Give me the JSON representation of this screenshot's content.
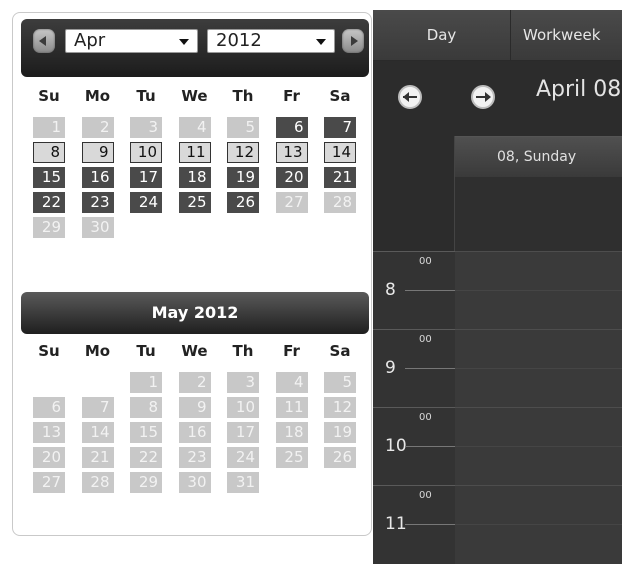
{
  "mini_calendar": {
    "month_select": "Apr",
    "year_select": "2012",
    "weekdays": [
      "Su",
      "Mo",
      "Tu",
      "We",
      "Th",
      "Fr",
      "Sa"
    ],
    "april": {
      "weeks": [
        [
          {
            "d": "1",
            "s": "other"
          },
          {
            "d": "2",
            "s": "other"
          },
          {
            "d": "3",
            "s": "other"
          },
          {
            "d": "4",
            "s": "other"
          },
          {
            "d": "5",
            "s": "other"
          },
          {
            "d": "6",
            "s": "dark"
          },
          {
            "d": "7",
            "s": "dark"
          }
        ],
        [
          {
            "d": "8",
            "s": "light"
          },
          {
            "d": "9",
            "s": "light"
          },
          {
            "d": "10",
            "s": "light"
          },
          {
            "d": "11",
            "s": "light"
          },
          {
            "d": "12",
            "s": "light"
          },
          {
            "d": "13",
            "s": "light"
          },
          {
            "d": "14",
            "s": "light"
          }
        ],
        [
          {
            "d": "15",
            "s": "dark"
          },
          {
            "d": "16",
            "s": "dark"
          },
          {
            "d": "17",
            "s": "dark"
          },
          {
            "d": "18",
            "s": "dark"
          },
          {
            "d": "19",
            "s": "dark"
          },
          {
            "d": "20",
            "s": "dark"
          },
          {
            "d": "21",
            "s": "dark"
          }
        ],
        [
          {
            "d": "22",
            "s": "dark"
          },
          {
            "d": "23",
            "s": "dark"
          },
          {
            "d": "24",
            "s": "dark"
          },
          {
            "d": "25",
            "s": "dark"
          },
          {
            "d": "26",
            "s": "dark"
          },
          {
            "d": "27",
            "s": "other"
          },
          {
            "d": "28",
            "s": "other"
          }
        ],
        [
          {
            "d": "29",
            "s": "other"
          },
          {
            "d": "30",
            "s": "other"
          },
          null,
          null,
          null,
          null,
          null
        ]
      ]
    },
    "may": {
      "title": "May 2012",
      "weeks": [
        [
          null,
          null,
          {
            "d": "1",
            "s": "other"
          },
          {
            "d": "2",
            "s": "other"
          },
          {
            "d": "3",
            "s": "other"
          },
          {
            "d": "4",
            "s": "other"
          },
          {
            "d": "5",
            "s": "other"
          }
        ],
        [
          {
            "d": "6",
            "s": "other"
          },
          {
            "d": "7",
            "s": "other"
          },
          {
            "d": "8",
            "s": "other"
          },
          {
            "d": "9",
            "s": "other"
          },
          {
            "d": "10",
            "s": "other"
          },
          {
            "d": "11",
            "s": "other"
          },
          {
            "d": "12",
            "s": "other"
          }
        ],
        [
          {
            "d": "13",
            "s": "other"
          },
          {
            "d": "14",
            "s": "other"
          },
          {
            "d": "15",
            "s": "other"
          },
          {
            "d": "16",
            "s": "other"
          },
          {
            "d": "17",
            "s": "other"
          },
          {
            "d": "18",
            "s": "other"
          },
          {
            "d": "19",
            "s": "other"
          }
        ],
        [
          {
            "d": "20",
            "s": "other"
          },
          {
            "d": "21",
            "s": "other"
          },
          {
            "d": "22",
            "s": "other"
          },
          {
            "d": "23",
            "s": "other"
          },
          {
            "d": "24",
            "s": "other"
          },
          {
            "d": "25",
            "s": "other"
          },
          {
            "d": "26",
            "s": "other"
          }
        ],
        [
          {
            "d": "27",
            "s": "other"
          },
          {
            "d": "28",
            "s": "other"
          },
          {
            "d": "29",
            "s": "other"
          },
          {
            "d": "30",
            "s": "other"
          },
          {
            "d": "31",
            "s": "other"
          },
          null,
          null
        ]
      ]
    }
  },
  "scheduler": {
    "tabs": [
      "Day",
      "Workweek"
    ],
    "date_title": "April 08",
    "column_header": "08, Sunday",
    "hours": [
      {
        "hour": "8",
        "min": "00"
      },
      {
        "hour": "9",
        "min": "00"
      },
      {
        "hour": "10",
        "min": "00"
      },
      {
        "hour": "11",
        "min": "00"
      }
    ]
  }
}
